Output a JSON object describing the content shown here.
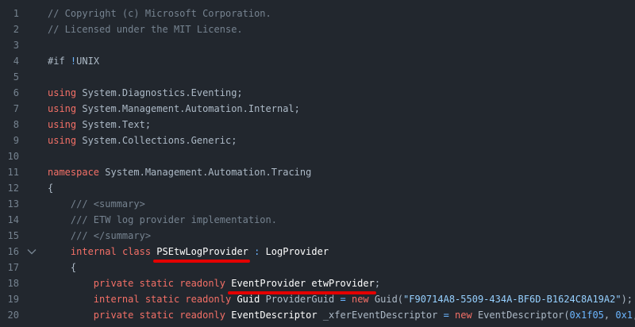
{
  "editor": {
    "fold_icon": "chevron-down-icon",
    "lines": [
      {
        "n": "1",
        "tokens": [
          {
            "t": "// Copyright (c) Microsoft Corporation.",
            "c": "comment"
          }
        ]
      },
      {
        "n": "2",
        "tokens": [
          {
            "t": "// Licensed under the MIT License.",
            "c": "comment"
          }
        ]
      },
      {
        "n": "3",
        "tokens": []
      },
      {
        "n": "4",
        "tokens": [
          {
            "t": "#if ",
            "c": ""
          },
          {
            "t": "!",
            "c": "op"
          },
          {
            "t": "UNIX",
            "c": ""
          }
        ]
      },
      {
        "n": "5",
        "tokens": []
      },
      {
        "n": "6",
        "tokens": [
          {
            "t": "using",
            "c": "kw"
          },
          {
            "t": " System.Diagnostics.Eventing;",
            "c": ""
          }
        ]
      },
      {
        "n": "7",
        "tokens": [
          {
            "t": "using",
            "c": "kw"
          },
          {
            "t": " System.Management.Automation.Internal;",
            "c": ""
          }
        ]
      },
      {
        "n": "8",
        "tokens": [
          {
            "t": "using",
            "c": "kw"
          },
          {
            "t": " System.Text;",
            "c": ""
          }
        ]
      },
      {
        "n": "9",
        "tokens": [
          {
            "t": "using",
            "c": "kw"
          },
          {
            "t": " System.Collections.Generic;",
            "c": ""
          }
        ]
      },
      {
        "n": "10",
        "tokens": []
      },
      {
        "n": "11",
        "tokens": [
          {
            "t": "namespace",
            "c": "kw"
          },
          {
            "t": " System.Management.Automation.Tracing",
            "c": ""
          }
        ]
      },
      {
        "n": "12",
        "tokens": [
          {
            "t": "{",
            "c": ""
          }
        ]
      },
      {
        "n": "13",
        "tokens": [
          {
            "t": "    /// <summary>",
            "c": "comment"
          }
        ]
      },
      {
        "n": "14",
        "tokens": [
          {
            "t": "    /// ETW log provider implementation.",
            "c": "comment"
          }
        ]
      },
      {
        "n": "15",
        "tokens": [
          {
            "t": "    /// </summary>",
            "c": "comment"
          }
        ]
      },
      {
        "n": "16",
        "fold": true,
        "tokens": [
          {
            "t": "    ",
            "c": ""
          },
          {
            "t": "internal",
            "c": "kw"
          },
          {
            "t": " ",
            "c": ""
          },
          {
            "t": "class",
            "c": "kw"
          },
          {
            "t": " ",
            "c": ""
          },
          {
            "t": "PSEtwLogProvider",
            "c": "em",
            "mark": true
          },
          {
            "t": " ",
            "c": ""
          },
          {
            "t": ":",
            "c": "op"
          },
          {
            "t": " LogProvider",
            "c": "em"
          }
        ]
      },
      {
        "n": "17",
        "tokens": [
          {
            "t": "    {",
            "c": ""
          }
        ]
      },
      {
        "n": "18",
        "tokens": [
          {
            "t": "        ",
            "c": ""
          },
          {
            "t": "private",
            "c": "kw"
          },
          {
            "t": " ",
            "c": ""
          },
          {
            "t": "static",
            "c": "kw"
          },
          {
            "t": " ",
            "c": ""
          },
          {
            "t": "readonly",
            "c": "kw"
          },
          {
            "t": " ",
            "c": ""
          },
          {
            "t": "EventProvider etwProvider",
            "c": "em",
            "mark": true
          },
          {
            "t": ";",
            "c": ""
          }
        ]
      },
      {
        "n": "19",
        "tokens": [
          {
            "t": "        ",
            "c": ""
          },
          {
            "t": "internal",
            "c": "kw"
          },
          {
            "t": " ",
            "c": ""
          },
          {
            "t": "static",
            "c": "kw"
          },
          {
            "t": " ",
            "c": ""
          },
          {
            "t": "readonly",
            "c": "kw"
          },
          {
            "t": " ",
            "c": ""
          },
          {
            "t": "Guid",
            "c": "em"
          },
          {
            "t": " ProviderGuid ",
            "c": ""
          },
          {
            "t": "=",
            "c": "op"
          },
          {
            "t": " ",
            "c": ""
          },
          {
            "t": "new",
            "c": "kw"
          },
          {
            "t": " Guid(",
            "c": ""
          },
          {
            "t": "\"F90714A8-5509-434A-BF6D-B1624C8A19A2\"",
            "c": "str"
          },
          {
            "t": ");",
            "c": ""
          }
        ]
      },
      {
        "n": "20",
        "tokens": [
          {
            "t": "        ",
            "c": ""
          },
          {
            "t": "private",
            "c": "kw"
          },
          {
            "t": " ",
            "c": ""
          },
          {
            "t": "static",
            "c": "kw"
          },
          {
            "t": " ",
            "c": ""
          },
          {
            "t": "readonly",
            "c": "kw"
          },
          {
            "t": " ",
            "c": ""
          },
          {
            "t": "EventDescriptor",
            "c": "em"
          },
          {
            "t": " _xferEventDescriptor ",
            "c": ""
          },
          {
            "t": "=",
            "c": "op"
          },
          {
            "t": " ",
            "c": ""
          },
          {
            "t": "new",
            "c": "kw"
          },
          {
            "t": " EventDescriptor(",
            "c": ""
          },
          {
            "t": "0x1f05",
            "c": "num"
          },
          {
            "t": ", ",
            "c": ""
          },
          {
            "t": "0x1",
            "c": "num"
          },
          {
            "t": ",",
            "c": ""
          }
        ]
      }
    ]
  }
}
